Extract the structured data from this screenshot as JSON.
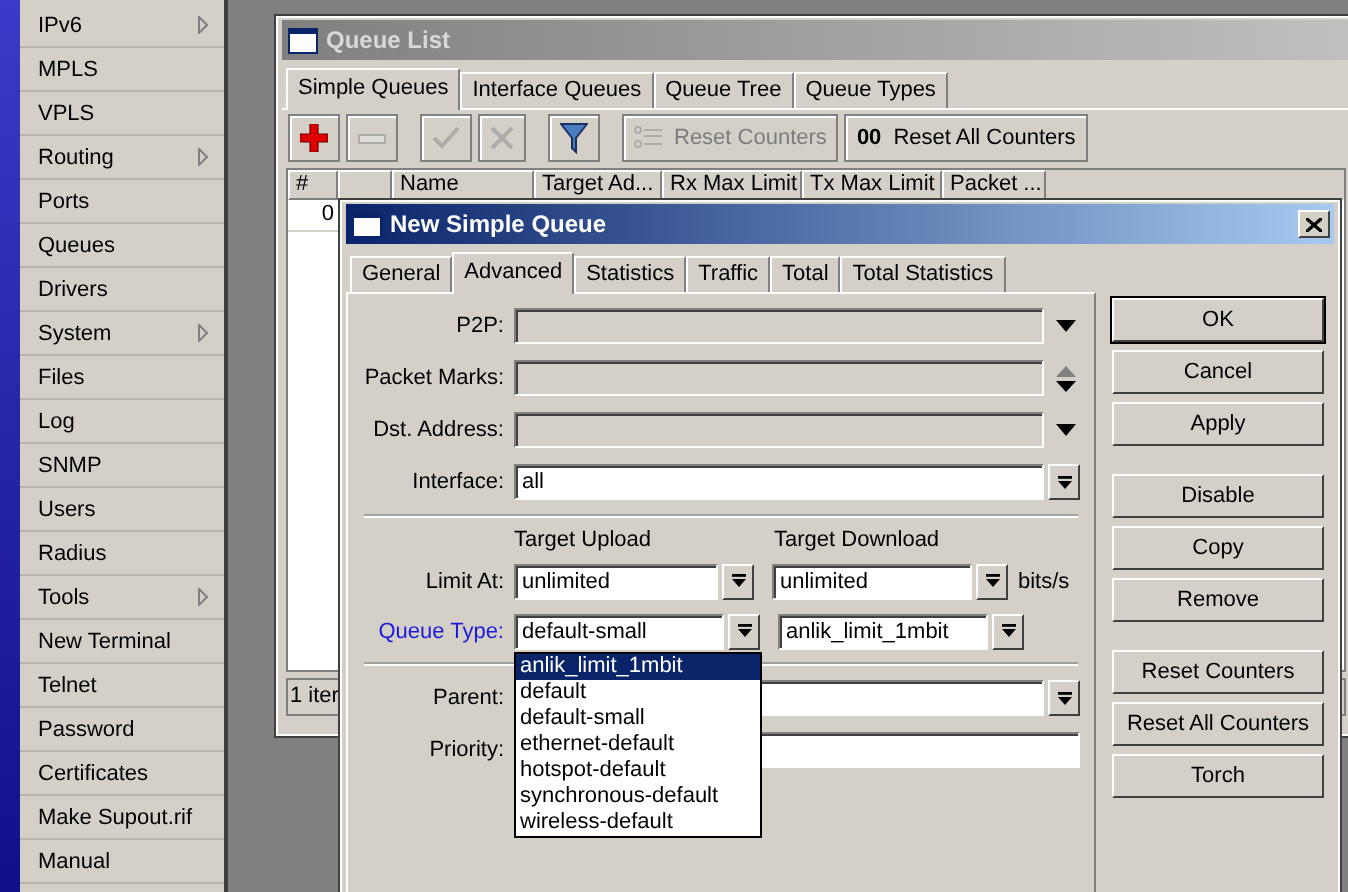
{
  "sidebar": {
    "items": [
      {
        "label": "IPv6",
        "submenu": true
      },
      {
        "label": "MPLS",
        "submenu": false
      },
      {
        "label": "VPLS",
        "submenu": false
      },
      {
        "label": "Routing",
        "submenu": true
      },
      {
        "label": "Ports",
        "submenu": false
      },
      {
        "label": "Queues",
        "submenu": false
      },
      {
        "label": "Drivers",
        "submenu": false
      },
      {
        "label": "System",
        "submenu": true
      },
      {
        "label": "Files",
        "submenu": false
      },
      {
        "label": "Log",
        "submenu": false
      },
      {
        "label": "SNMP",
        "submenu": false
      },
      {
        "label": "Users",
        "submenu": false
      },
      {
        "label": "Radius",
        "submenu": false
      },
      {
        "label": "Tools",
        "submenu": true
      },
      {
        "label": "New Terminal",
        "submenu": false
      },
      {
        "label": "Telnet",
        "submenu": false
      },
      {
        "label": "Password",
        "submenu": false
      },
      {
        "label": "Certificates",
        "submenu": false
      },
      {
        "label": "Make Supout.rif",
        "submenu": false
      },
      {
        "label": "Manual",
        "submenu": false
      }
    ]
  },
  "queue_list": {
    "title": "Queue List",
    "tabs": [
      {
        "label": "Simple Queues",
        "selected": true
      },
      {
        "label": "Interface Queues",
        "selected": false
      },
      {
        "label": "Queue Tree",
        "selected": false
      },
      {
        "label": "Queue Types",
        "selected": false
      }
    ],
    "toolbar": [
      {
        "kind": "add",
        "disabled": false
      },
      {
        "kind": "remove",
        "disabled": true
      },
      {
        "kind": "enable",
        "disabled": true
      },
      {
        "kind": "disable",
        "disabled": true
      },
      {
        "kind": "filter",
        "disabled": false
      },
      {
        "kind": "reset",
        "label": "Reset Counters",
        "disabled": true
      },
      {
        "kind": "reset_all",
        "icon_text": "00",
        "label": "Reset All Counters",
        "disabled": false
      }
    ],
    "columns": [
      "#",
      "",
      "Name",
      "Target Ad...",
      "Rx Max Limit",
      "Tx Max Limit",
      "Packet ..."
    ],
    "rows": [
      [
        "0"
      ]
    ],
    "status": "1 iter"
  },
  "dialog": {
    "title": "New Simple Queue",
    "tabs": [
      {
        "label": "General",
        "selected": false
      },
      {
        "label": "Advanced",
        "selected": true
      },
      {
        "label": "Statistics",
        "selected": false
      },
      {
        "label": "Traffic",
        "selected": false
      },
      {
        "label": "Total",
        "selected": false
      },
      {
        "label": "Total Statistics",
        "selected": false
      }
    ],
    "fields": [
      {
        "label": "P2P:",
        "kind": "arrow",
        "disabled": true
      },
      {
        "label": "Packet Marks:",
        "kind": "updown",
        "disabled": true
      },
      {
        "label": "Dst. Address:",
        "kind": "arrow",
        "disabled": true
      },
      {
        "label": "Interface:",
        "value": "all",
        "kind": "combo",
        "disabled": false
      }
    ],
    "limits": {
      "upload_header": "Target Upload",
      "download_header": "Target Download",
      "rows": [
        {
          "label": "Limit At:",
          "link": false,
          "upload": "unlimited",
          "download": "unlimited",
          "unit": "bits/s"
        },
        {
          "label": "Queue Type:",
          "link": true,
          "upload": "default-small",
          "download": "anlik_limit_1mbit",
          "open_list": [
            {
              "label": "anlik_limit_1mbit",
              "selected": true
            },
            {
              "label": "default",
              "selected": false
            },
            {
              "label": "default-small",
              "selected": false
            },
            {
              "label": "ethernet-default",
              "selected": false
            },
            {
              "label": "hotspot-default",
              "selected": false
            },
            {
              "label": "synchronous-default",
              "selected": false
            },
            {
              "label": "wireless-default",
              "selected": false
            }
          ]
        }
      ]
    },
    "lower_fields": [
      {
        "label": "Parent:",
        "kind": "combo"
      },
      {
        "label": "Priority:",
        "kind": "text"
      }
    ],
    "button_groups": [
      [
        {
          "label": "OK",
          "default": true
        },
        {
          "label": "Cancel",
          "default": false
        },
        {
          "label": "Apply",
          "default": false
        }
      ],
      [
        {
          "label": "Disable",
          "default": false
        },
        {
          "label": "Copy",
          "default": false
        },
        {
          "label": "Remove",
          "default": false
        }
      ],
      [
        {
          "label": "Reset Counters",
          "default": false
        },
        {
          "label": "Reset All Counters",
          "default": false
        },
        {
          "label": "Torch",
          "default": false
        }
      ]
    ]
  }
}
